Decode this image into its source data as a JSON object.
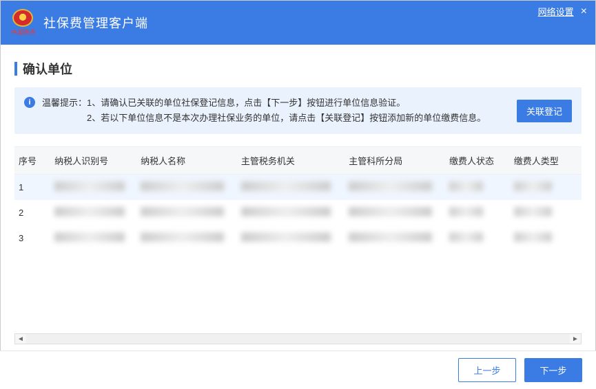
{
  "header": {
    "app_title": "社保费管理客户端",
    "logo_text": "中国税务",
    "network_settings": "网络设置"
  },
  "page": {
    "title": "确认单位"
  },
  "tip": {
    "label": "温馨提示：",
    "line1": "1、请确认已关联的单位社保登记信息，点击【下一步】按钮进行单位信息验证。",
    "line2": "2、若以下单位信息不是本次办理社保业务的单位，请点击【关联登记】按钮添加新的单位缴费信息。",
    "link_button": "关联登记"
  },
  "table": {
    "columns": [
      "序号",
      "纳税人识别号",
      "纳税人名称",
      "主管税务机关",
      "主管科所分局",
      "缴费人状态",
      "缴费人类型"
    ],
    "rows": [
      {
        "idx": "1",
        "tid": "",
        "name": "",
        "auth": "",
        "bureau": "",
        "status": "",
        "type": ""
      },
      {
        "idx": "2",
        "tid": "",
        "name": "",
        "auth": "",
        "bureau": "",
        "status": "",
        "type": ""
      },
      {
        "idx": "3",
        "tid": "",
        "name": "",
        "auth": "",
        "bureau": "",
        "status": "",
        "type": ""
      }
    ]
  },
  "footer": {
    "prev": "上一步",
    "next": "下一步"
  }
}
